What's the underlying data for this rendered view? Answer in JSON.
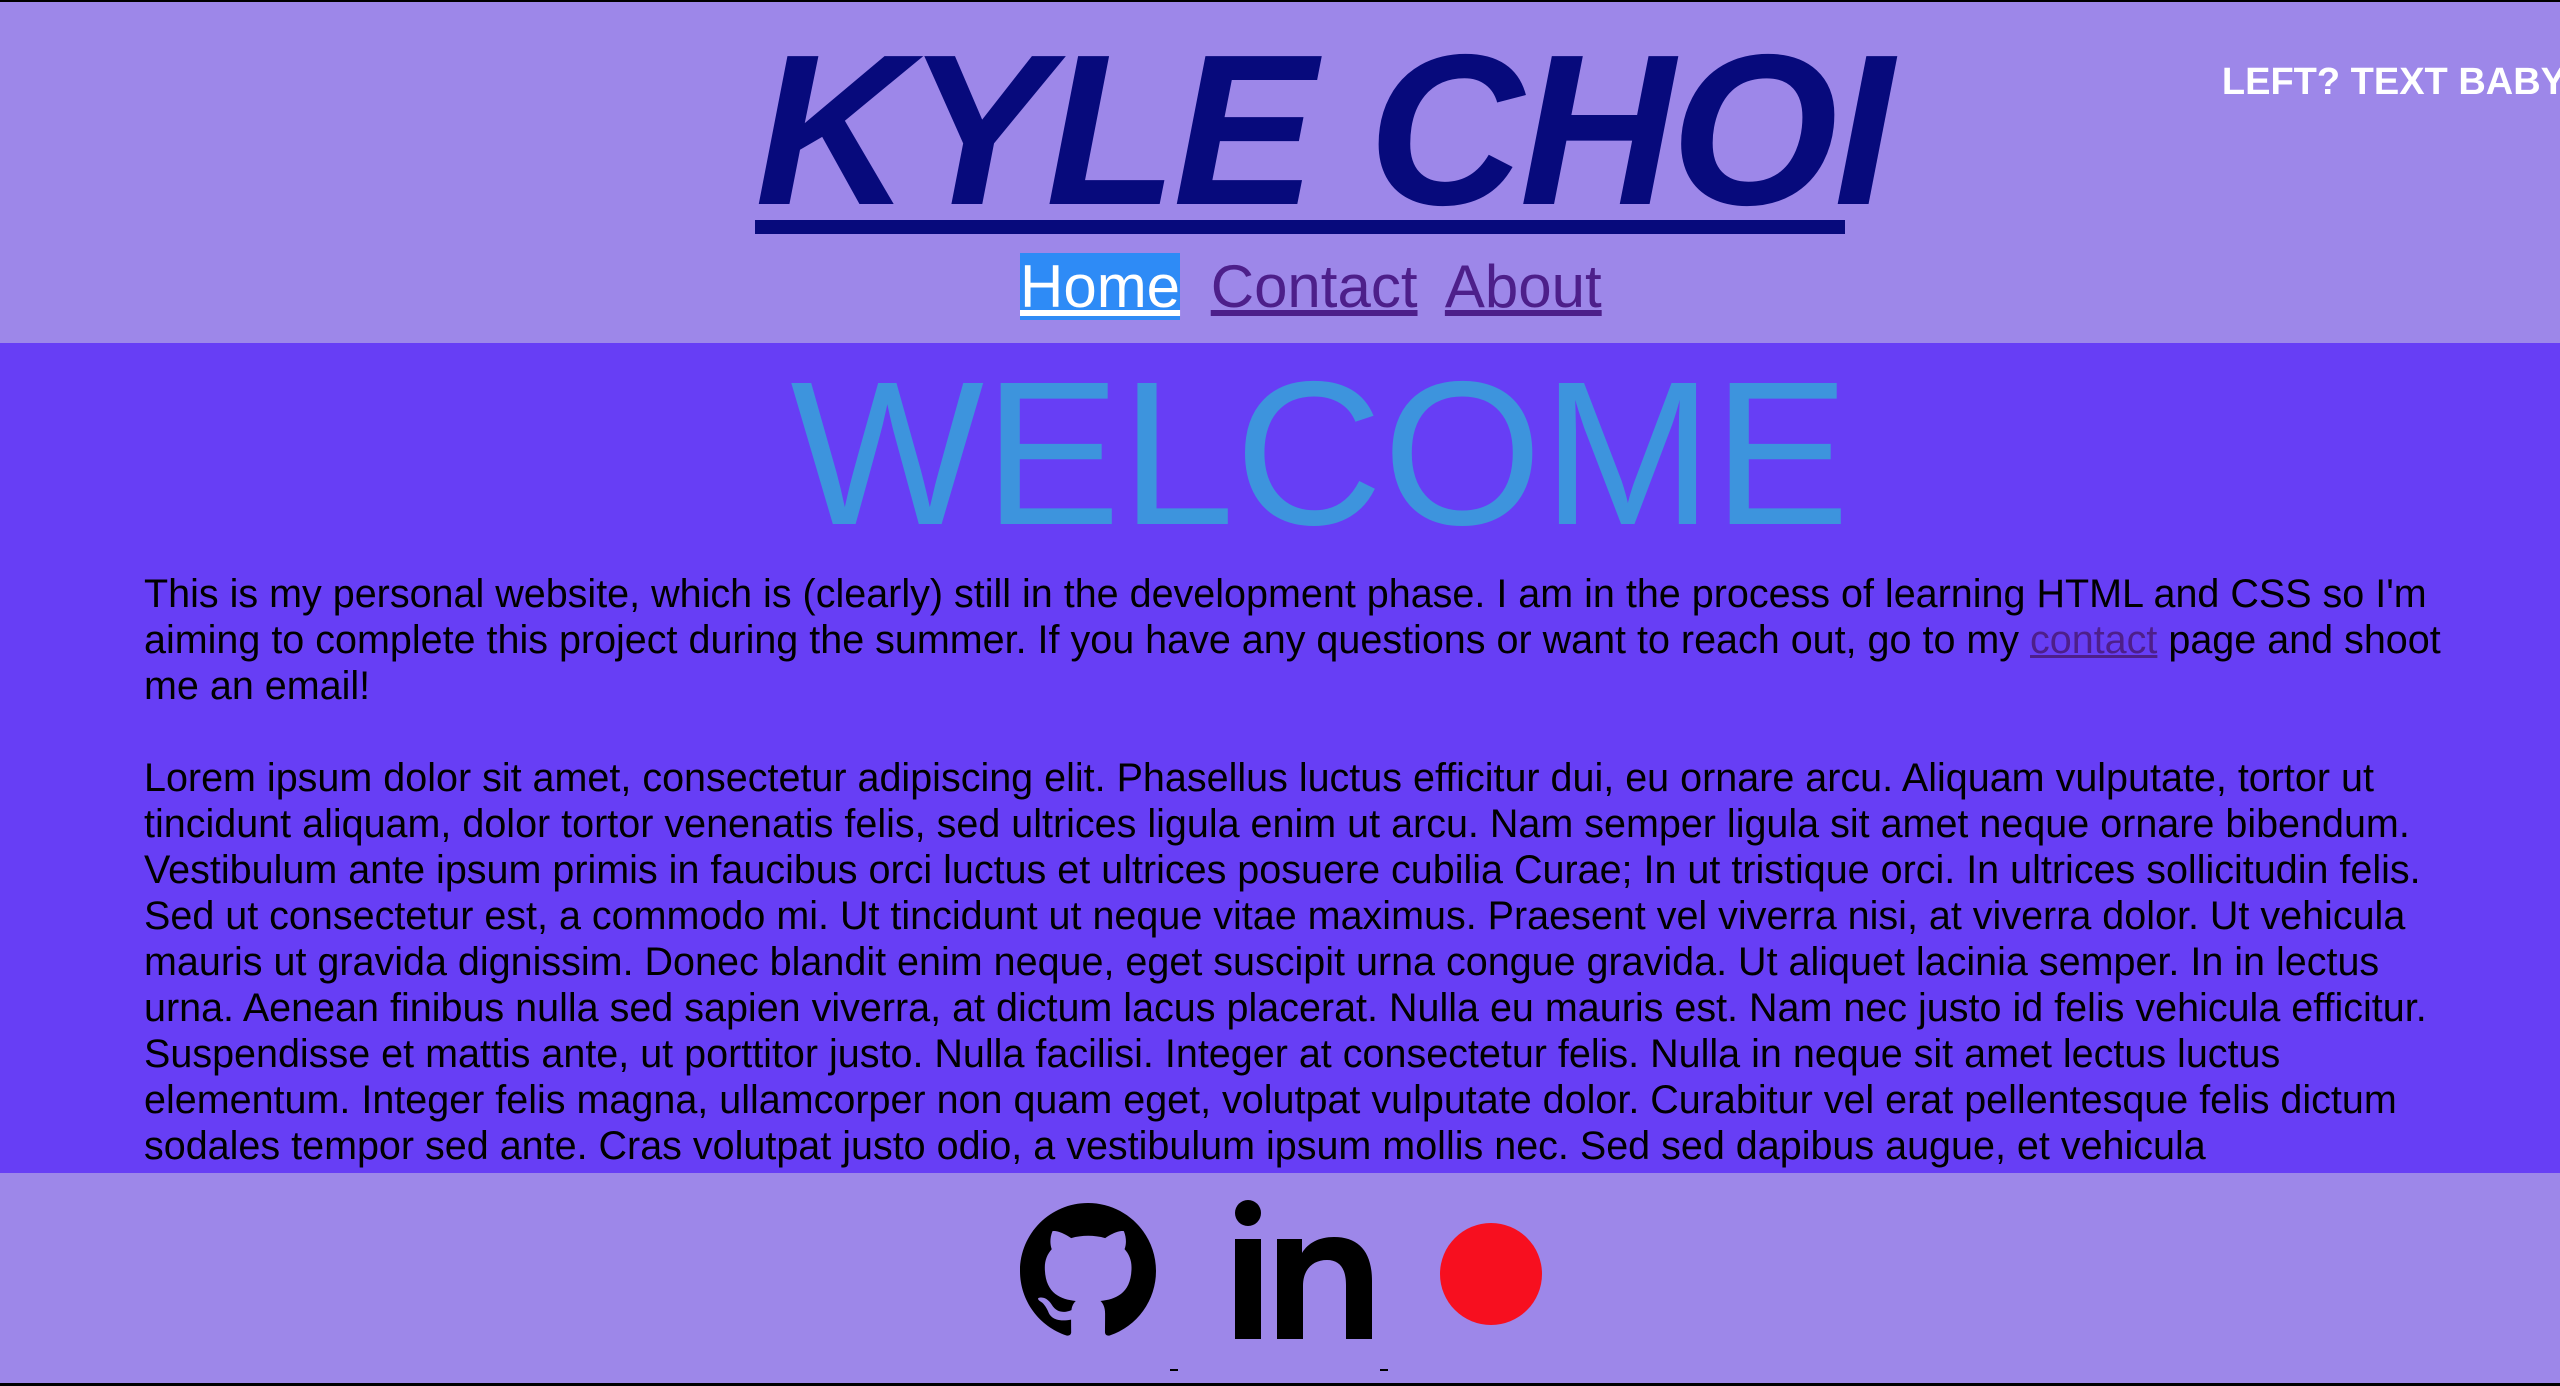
{
  "header": {
    "title": "KYLE CHOI",
    "side_text": "LEFT? TEXT BABY",
    "nav": [
      {
        "label": "Home",
        "active": true
      },
      {
        "label": "Contact",
        "active": false
      },
      {
        "label": "About",
        "active": false
      }
    ]
  },
  "main": {
    "welcome": "WELCOME",
    "intro_before_link": "This is my personal website, which is (clearly) still in the development phase. I am in the process of learning HTML and CSS so I'm aiming to complete this project during the summer. If you have any questions or want to reach out, go to my ",
    "intro_link": "contact",
    "intro_after_link": " page and shoot me an email!",
    "lorem": "Lorem ipsum dolor sit amet, consectetur adipiscing elit. Phasellus luctus efficitur dui, eu ornare arcu. Aliquam vulputate, tortor ut tincidunt aliquam, dolor tortor venenatis felis, sed ultrices ligula enim ut arcu. Nam semper ligula sit amet neque ornare bibendum. Vestibulum ante ipsum primis in faucibus orci luctus et ultrices posuere cubilia Curae; In ut tristique orci. In ultrices sollicitudin felis. Sed ut consectetur est, a commodo mi. Ut tincidunt ut neque vitae maximus. Praesent vel viverra nisi, at viverra dolor. Ut vehicula mauris ut gravida dignissim. Donec blandit enim neque, eget suscipit urna congue gravida. Ut aliquet lacinia semper. In in lectus urna. Aenean finibus nulla sed sapien viverra, at dictum lacus placerat. Nulla eu mauris est. Nam nec justo id felis vehicula efficitur. Suspendisse et mattis ante, ut porttitor justo. Nulla facilisi. Integer at consectetur felis. Nulla in neque sit amet lectus luctus elementum. Integer felis magna, ullamcorper non quam eget, volutpat vulputate dolor. Curabitur vel erat pellentesque felis dictum sodales tempor sed ante. Cras volutpat justo odio, a vestibulum ipsum mollis nec. Sed sed dapibus augue, et vehicula"
  },
  "footer": {
    "icons": [
      "github-icon",
      "linkedin-icon",
      "red-circle-icon"
    ]
  },
  "colors": {
    "header_bg": "#9d87e9",
    "main_bg": "#673ef5",
    "title": "#070a7c",
    "welcome": "#3d94dd",
    "link": "#4d1f8a",
    "active_nav_bg": "#2e8bf6",
    "dot": "#f70f1f"
  }
}
